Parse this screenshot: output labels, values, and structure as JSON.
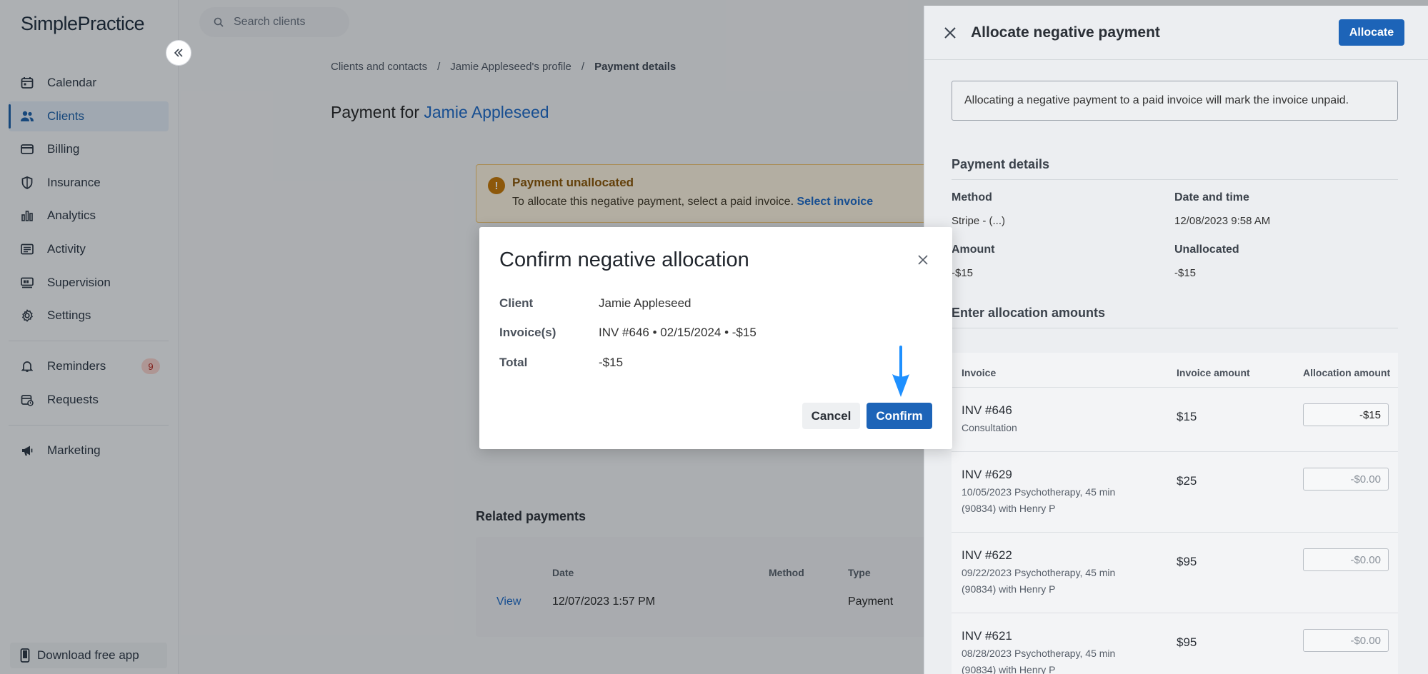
{
  "app": {
    "logo": "SimplePractice"
  },
  "sidebar": {
    "items": [
      {
        "label": "Calendar",
        "icon": "calendar-icon"
      },
      {
        "label": "Clients",
        "icon": "users-icon",
        "active": true
      },
      {
        "label": "Billing",
        "icon": "credit-card-icon"
      },
      {
        "label": "Insurance",
        "icon": "shield-icon"
      },
      {
        "label": "Analytics",
        "icon": "bar-chart-icon"
      },
      {
        "label": "Activity",
        "icon": "list-icon"
      },
      {
        "label": "Supervision",
        "icon": "supervision-icon"
      },
      {
        "label": "Settings",
        "icon": "gear-icon"
      }
    ],
    "reminders": {
      "label": "Reminders",
      "badge": "9"
    },
    "requests": {
      "label": "Requests"
    },
    "marketing": {
      "label": "Marketing"
    },
    "download": "Download free app"
  },
  "search": {
    "placeholder": "Search clients"
  },
  "breadcrumb": {
    "item1": "Clients and contacts",
    "item2": "Jamie Appleseed's profile",
    "current": "Payment details",
    "sep": "/"
  },
  "page": {
    "title_prefix": "Payment for",
    "client_name": "Jamie Appleseed"
  },
  "alert": {
    "title": "Payment unallocated",
    "message": "To allocate this negative payment, select a paid invoice.",
    "link": "Select invoice"
  },
  "related": {
    "title": "Related payments",
    "headers": {
      "date": "Date",
      "method": "Method",
      "type": "Type"
    },
    "row": {
      "view": "View",
      "date": "12/07/2023 1:57 PM",
      "type": "Payment"
    }
  },
  "drawer": {
    "title": "Allocate negative payment",
    "allocate_label": "Allocate",
    "info": "Allocating a negative payment to a paid invoice will mark the invoice unpaid.",
    "payment_details": {
      "heading": "Payment details",
      "method_label": "Method",
      "method_value": "Stripe - (...)",
      "date_label": "Date and time",
      "date_value": "12/08/2023 9:58 AM",
      "amount_label": "Amount",
      "amount_value": "-$15",
      "unallocated_label": "Unallocated",
      "unallocated_value": "-$15"
    },
    "allocation": {
      "heading": "Enter allocation amounts",
      "headers": {
        "invoice": "Invoice",
        "invoice_amount": "Invoice amount",
        "allocation_amount": "Allocation amount"
      },
      "rows": [
        {
          "invoice": "INV #646",
          "desc": "Consultation",
          "amount": "$15",
          "value": "-$15",
          "placeholder": ""
        },
        {
          "invoice": "INV #629",
          "desc": "10/05/2023 Psychotherapy, 45 min (90834) with Henry P",
          "amount": "$25",
          "value": "",
          "placeholder": "-$0.00"
        },
        {
          "invoice": "INV #622",
          "desc": "09/22/2023 Psychotherapy, 45 min (90834) with Henry P",
          "amount": "$95",
          "value": "",
          "placeholder": "-$0.00"
        },
        {
          "invoice": "INV #621",
          "desc": "08/28/2023 Psychotherapy, 45 min (90834) with Henry P",
          "amount": "$95",
          "value": "",
          "placeholder": "-$0.00"
        }
      ]
    }
  },
  "modal": {
    "title": "Confirm negative allocation",
    "client_label": "Client",
    "client_value": "Jamie Appleseed",
    "invoices_label": "Invoice(s)",
    "invoices_value": "INV #646 • 02/15/2024 • -$15",
    "total_label": "Total",
    "total_value": "-$15",
    "cancel_label": "Cancel",
    "confirm_label": "Confirm"
  },
  "colors": {
    "accent": "#1d64b8",
    "link": "#1a68c7",
    "warning": "#c77700",
    "arrow": "#1e90ff"
  }
}
